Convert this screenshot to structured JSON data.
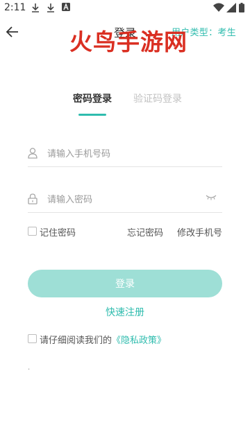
{
  "status_bar": {
    "time": "2:11",
    "icons": [
      "download-icon",
      "download-icon",
      "a-badge-icon",
      "wifi-icon",
      "signal-icon",
      "battery-icon"
    ]
  },
  "header": {
    "title": "登录",
    "user_type": "用户类型：考生"
  },
  "watermark": "火鸟手游网",
  "tabs": [
    {
      "label": "密码登录",
      "active": true
    },
    {
      "label": "验证码登录",
      "active": false
    }
  ],
  "form": {
    "phone_placeholder": "请输入手机号码",
    "password_placeholder": "请输入密码"
  },
  "options": {
    "remember": "记住密码",
    "forgot": "忘记密码",
    "change_phone": "修改手机号"
  },
  "login_button": "登录",
  "register_link": "快速注册",
  "privacy": {
    "prefix": "请仔细阅读我们的",
    "link": "《隐私政策》"
  },
  "colors": {
    "accent": "#2fbcae",
    "button": "#9edfd6",
    "watermark": "#d9291b"
  }
}
